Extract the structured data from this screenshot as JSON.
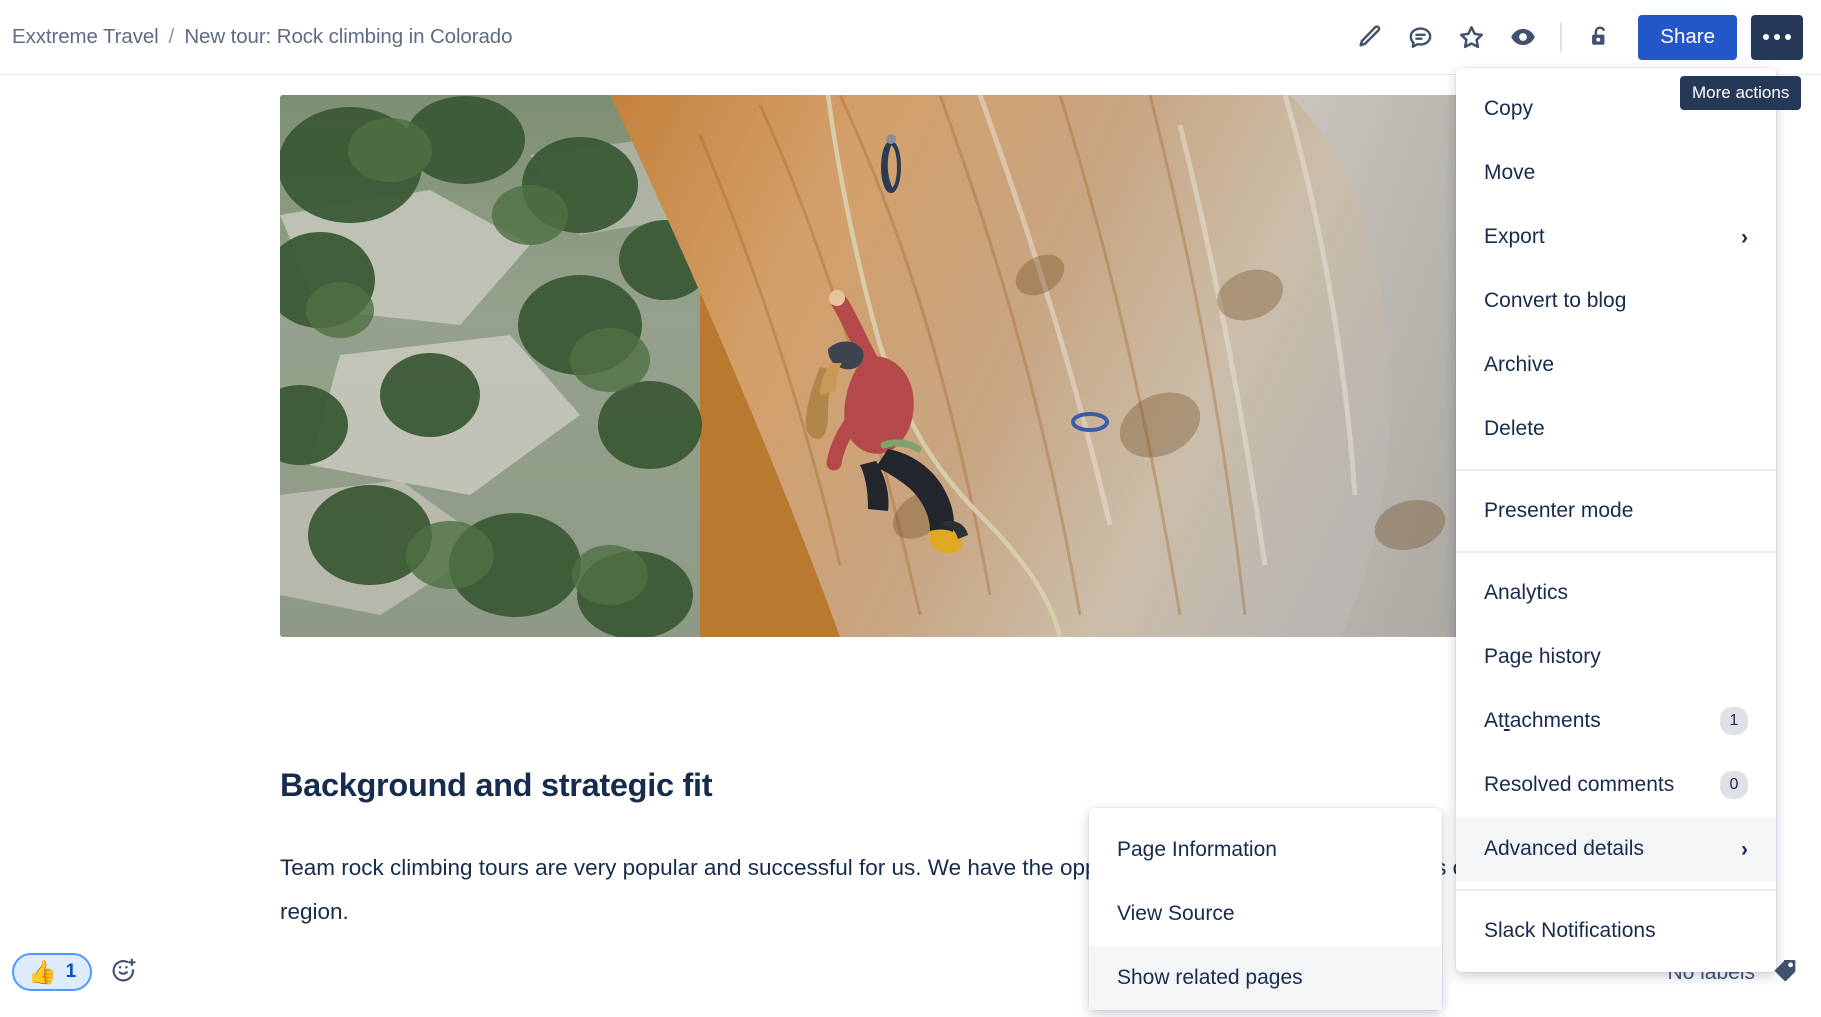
{
  "breadcrumb": {
    "space": "Exxtreme Travel",
    "separator": "/",
    "page": "New tour: Rock climbing in Colorado"
  },
  "header": {
    "icons": [
      {
        "name": "edit-pencil-icon",
        "label": "Edit"
      },
      {
        "name": "comment-icon",
        "label": "Comments"
      },
      {
        "name": "star-icon",
        "label": "Favorite"
      },
      {
        "name": "watch-eye-icon",
        "label": "Watch"
      },
      {
        "name": "unlock-padlock-icon",
        "label": "Restrictions"
      }
    ],
    "share_label": "Share",
    "more_actions_label": "More actions",
    "share_color": "#2357c9",
    "more_button_color": "#253858"
  },
  "tooltip": {
    "text": "More actions"
  },
  "content": {
    "hero_image_alt": "Rock climber on an orange limestone cliff",
    "heading": "Background and strategic fit",
    "paragraph": "Team rock climbing tours are very popular and successful for us. We have the opportunity to be the first to launch this offer in the region."
  },
  "menu": {
    "items": [
      {
        "label": "Copy",
        "type": "item"
      },
      {
        "label": "Move",
        "type": "item"
      },
      {
        "label": "Export",
        "type": "item",
        "submenu": true
      },
      {
        "label": "Convert to blog",
        "type": "item"
      },
      {
        "label": "Archive",
        "type": "item"
      },
      {
        "label": "Delete",
        "type": "item"
      },
      {
        "type": "divider"
      },
      {
        "label": "Presenter mode",
        "type": "item"
      },
      {
        "type": "divider"
      },
      {
        "label": "Analytics",
        "type": "item"
      },
      {
        "label": "Page history",
        "type": "item"
      },
      {
        "label": "Attachments",
        "type": "item",
        "badge": "1",
        "accesskey_index": 2
      },
      {
        "label": "Resolved comments",
        "type": "item",
        "badge": "0"
      },
      {
        "label": "Advanced details",
        "type": "item",
        "submenu": true,
        "highlight": true
      },
      {
        "type": "divider"
      },
      {
        "label": "Slack Notifications",
        "type": "item"
      }
    ],
    "submenu_chevron": "›"
  },
  "submenu": {
    "items": [
      {
        "label": "Page Information"
      },
      {
        "label": "View Source"
      },
      {
        "label": "Show related pages",
        "highlight": true
      }
    ]
  },
  "footer": {
    "reaction": {
      "emoji": "👍",
      "count": "1"
    },
    "add_reaction_label": "Add reaction",
    "labels_text": "No labels",
    "tag_icon": "tag-icon"
  },
  "colors": {
    "accent_blue": "#2357c9",
    "text_dark": "#172b4d",
    "text_muted": "#5e6c84",
    "highlight_bg": "#f4f5f7",
    "divider": "#ebecf0"
  }
}
